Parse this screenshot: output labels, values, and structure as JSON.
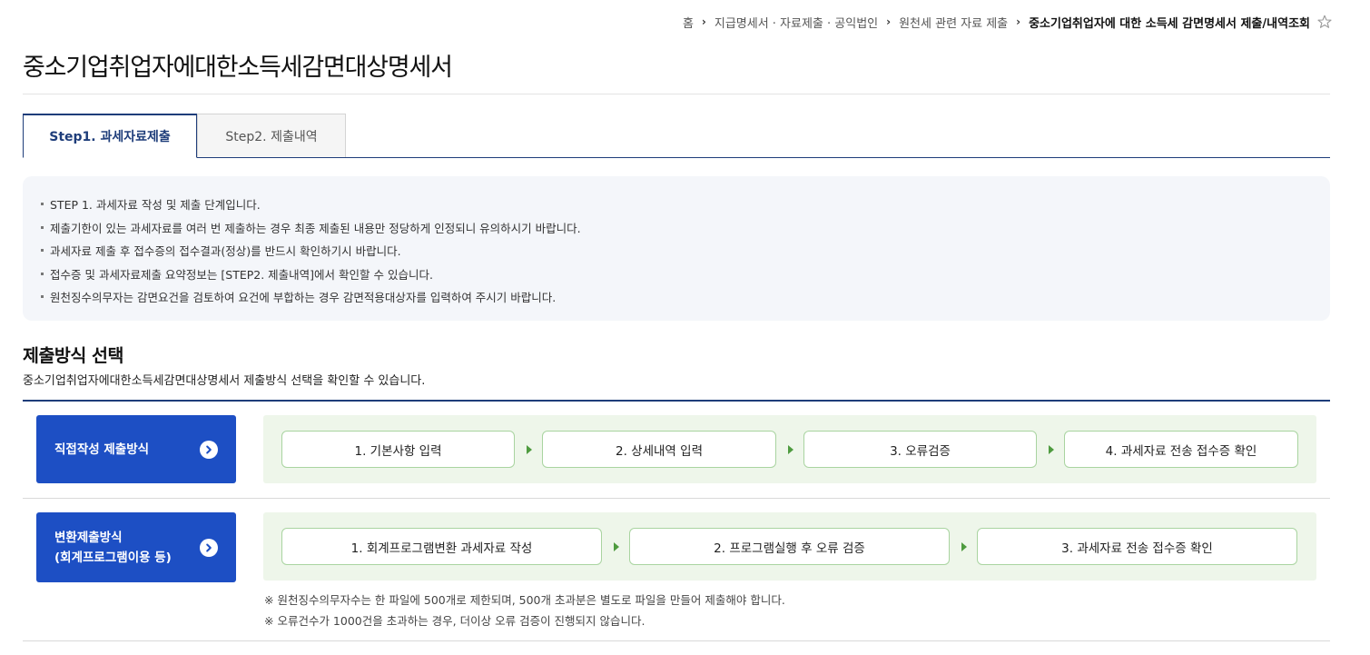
{
  "breadcrumb": {
    "items": [
      "홈",
      "지급명세서 · 자료제출 · 공익법인",
      "원천세 관련 자료 제출",
      "중소기업취업자에 대한 소득세 감면명세서 제출/내역조회"
    ],
    "separator": "›",
    "favorite_icon": "star-outline-icon"
  },
  "page": {
    "title": "중소기업취업자에대한소득세감면대상명세서"
  },
  "tabs": [
    {
      "label": "Step1. 과세자료제출",
      "active": true
    },
    {
      "label": "Step2. 제출내역",
      "active": false
    }
  ],
  "notice": {
    "items": [
      "STEP 1. 과세자료 작성 및 제출 단계입니다.",
      "제출기한이 있는 과세자료를 여러 번 제출하는 경우 최종 제출된 내용만 정당하게 인정되니 유의하시기 바랍니다.",
      "과세자료 제출 후 접수증의 접수결과(정상)를 반드시 확인하기시 바랍니다.",
      "접수증 및 과세자료제출 요약정보는 [STEP2. 제출내역]에서 확인할 수 있습니다.",
      "원천징수의무자는 감면요건을 검토하여 요건에 부합하는 경우 감면적용대상자를 입력하여 주시기 바랍니다."
    ]
  },
  "section": {
    "title": "제출방식 선택",
    "description": "중소기업취업자에대한소득세감면대상명세서 제출방식 선택을 확인할 수 있습니다."
  },
  "methods": {
    "direct": {
      "label": "직접작성 제출방식",
      "icon": "chevron-right-circle-icon",
      "steps": [
        "1. 기본사항 입력",
        "2. 상세내역 입력",
        "3. 오류검증",
        "4. 과세자료 전송 접수증 확인"
      ]
    },
    "convert": {
      "label_line1": "변환제출방식",
      "label_line2": "(회계프로그램이용 등)",
      "icon": "chevron-right-circle-icon",
      "steps": [
        "1. 회계프로그램변환 과세자료 작성",
        "2. 프로그램실행 후 오류 검증",
        "3. 과세자료 전송 접수증 확인"
      ],
      "notes": [
        "※ 원천징수의무자수는 한 파일에 500개로 제한되며, 500개 초과분은 별도로 파일을 만들어 제출해야 합니다.",
        "※ 오류건수가 1000건을 초과하는 경우, 더이상 오류 검증이 진행되지 않습니다."
      ]
    }
  },
  "colors": {
    "primary_navy": "#1e3d7a",
    "button_blue": "#1d4fc4",
    "step_panel_bg": "#eef6ea",
    "step_border": "#a9d4a0",
    "arrow_green": "#4e9b3f",
    "notice_bg": "#f4f6fa"
  }
}
